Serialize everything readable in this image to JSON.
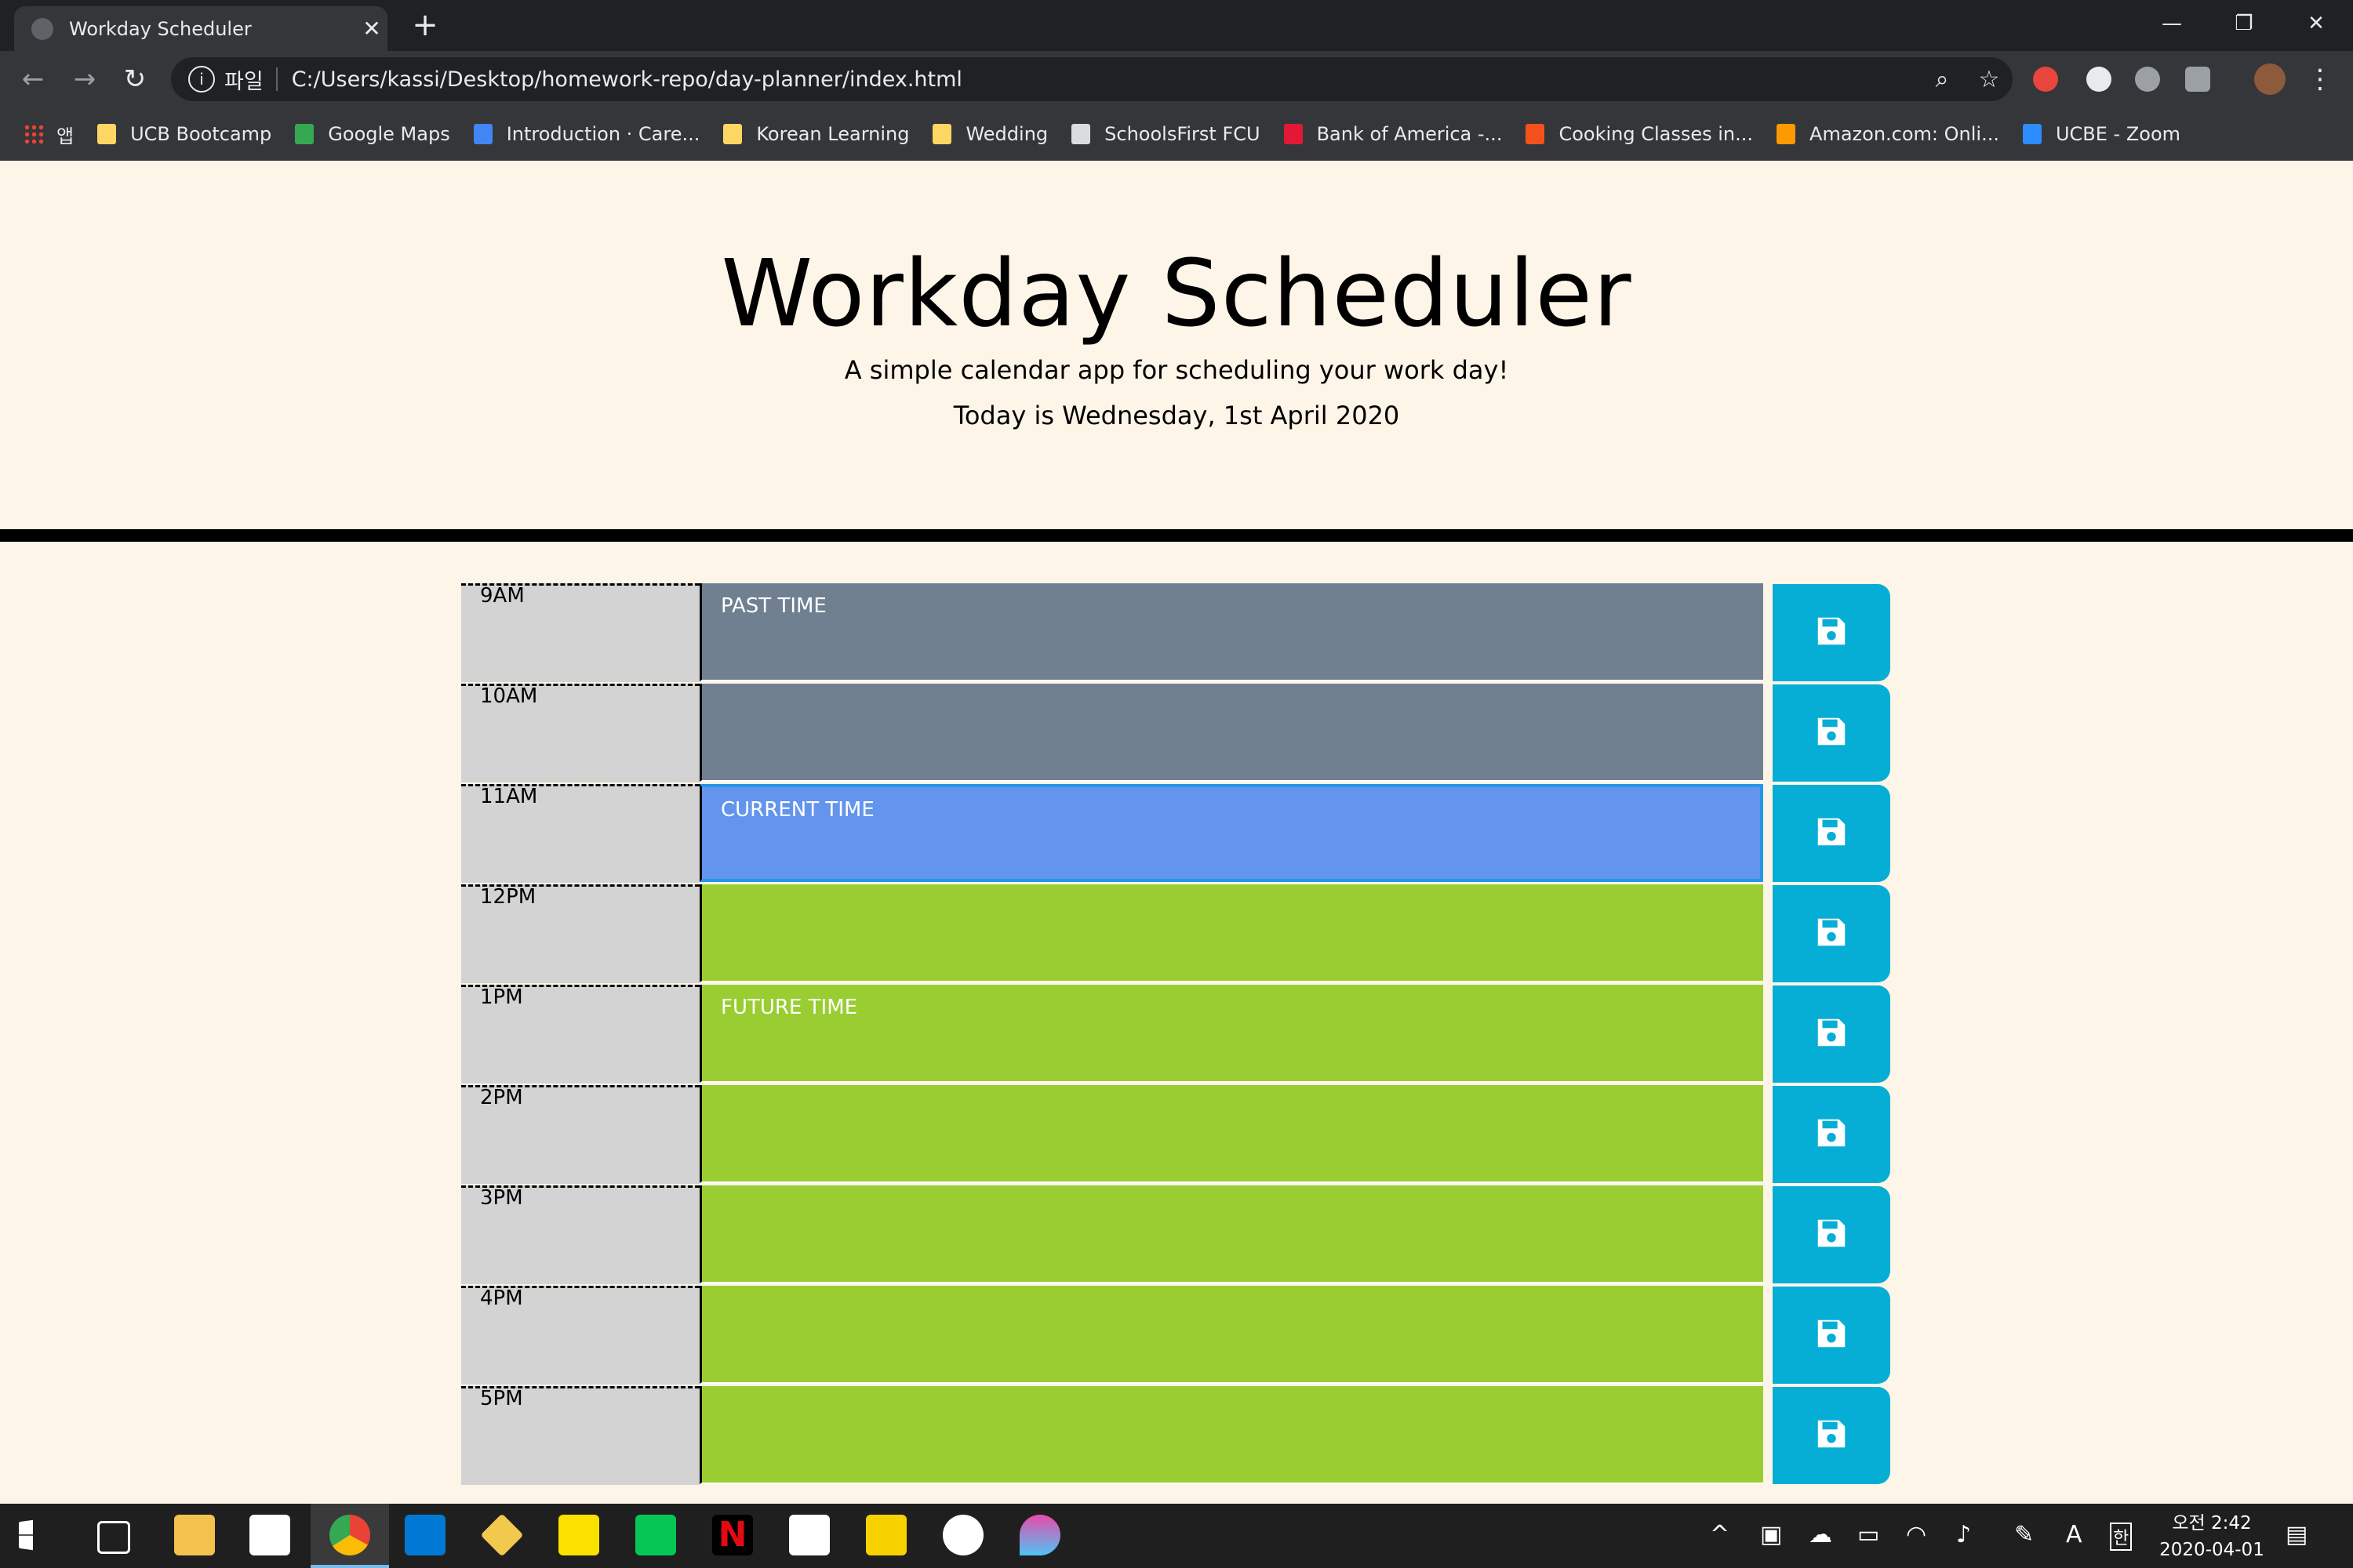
{
  "browser": {
    "tab_title": "Workday Scheduler",
    "new_tab": "+",
    "scheme_label": "파일",
    "url": "C:/Users/kassi/Desktop/homework-repo/day-planner/index.html",
    "apps_label": "앱",
    "bookmarks": [
      {
        "label": "UCB Bootcamp",
        "icon": "folder-icon",
        "color": "#fdd663"
      },
      {
        "label": "Google Maps",
        "icon": "maps-pin-icon",
        "color": "#34a853"
      },
      {
        "label": "Introduction · Care...",
        "icon": "stack-icon",
        "color": "#4285f4"
      },
      {
        "label": "Korean Learning",
        "icon": "folder-icon",
        "color": "#fdd663"
      },
      {
        "label": "Wedding",
        "icon": "folder-icon",
        "color": "#fdd663"
      },
      {
        "label": "SchoolsFirst FCU",
        "icon": "page-icon",
        "color": "#dadce0"
      },
      {
        "label": "Bank of America -...",
        "icon": "boa-icon",
        "color": "#e31837"
      },
      {
        "label": "Cooking Classes in...",
        "icon": "cooking-icon",
        "color": "#f4511e"
      },
      {
        "label": "Amazon.com: Onli...",
        "icon": "amazon-icon",
        "color": "#ff9900"
      },
      {
        "label": "UCBE - Zoom",
        "icon": "zoom-icon",
        "color": "#2d8cff"
      }
    ]
  },
  "header": {
    "title": "Workday Scheduler",
    "lead": "A simple calendar app for scheduling your work day!",
    "today": "Today is Wednesday, 1st April 2020"
  },
  "colors": {
    "past": "#708090",
    "present": "#6495ed",
    "future": "#9acd32",
    "save": "#06aed5",
    "hour": "#d3d3d3"
  },
  "rows": [
    {
      "hour": "9AM",
      "state": "past",
      "text": "PAST TIME"
    },
    {
      "hour": "10AM",
      "state": "past",
      "text": ""
    },
    {
      "hour": "11AM",
      "state": "present",
      "text": "CURRENT TIME"
    },
    {
      "hour": "12PM",
      "state": "future",
      "text": ""
    },
    {
      "hour": "1PM",
      "state": "future",
      "text": "FUTURE TIME"
    },
    {
      "hour": "2PM",
      "state": "future",
      "text": ""
    },
    {
      "hour": "3PM",
      "state": "future",
      "text": ""
    },
    {
      "hour": "4PM",
      "state": "future",
      "text": ""
    },
    {
      "hour": "5PM",
      "state": "future",
      "text": ""
    }
  ],
  "taskbar": {
    "clock_time": "오전 2:42",
    "clock_date": "2020-04-01",
    "ime_label": "A",
    "ime_mode": "한"
  }
}
